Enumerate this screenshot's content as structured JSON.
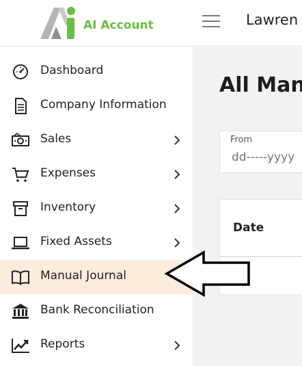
{
  "header": {
    "brand": "AI Account",
    "user_name": "Lawren",
    "logo_colors": {
      "grey": "#a9a9a9",
      "green": "#6cbd45"
    }
  },
  "sidebar": {
    "active_item": "Manual Journal",
    "active_background": "#fdebdc",
    "items": [
      {
        "label": "Dashboard",
        "icon": "dashboard-gauge-icon",
        "has_submenu": false
      },
      {
        "label": "Company Information",
        "icon": "document-icon",
        "has_submenu": false
      },
      {
        "label": "Sales",
        "icon": "money-icon",
        "has_submenu": true
      },
      {
        "label": "Expenses",
        "icon": "cart-icon",
        "has_submenu": true
      },
      {
        "label": "Inventory",
        "icon": "archive-box-icon",
        "has_submenu": true
      },
      {
        "label": "Fixed Assets",
        "icon": "laptop-icon",
        "has_submenu": true
      },
      {
        "label": "Manual Journal",
        "icon": "book-icon",
        "has_submenu": false
      },
      {
        "label": "Bank Reconciliation",
        "icon": "bank-icon",
        "has_submenu": false
      },
      {
        "label": "Reports",
        "icon": "trend-chart-icon",
        "has_submenu": true
      }
    ]
  },
  "main": {
    "title": "All Manu",
    "filter": {
      "from_label": "From",
      "from_placeholder": "dd-----yyyy"
    },
    "table": {
      "columns": [
        "Date"
      ]
    }
  }
}
